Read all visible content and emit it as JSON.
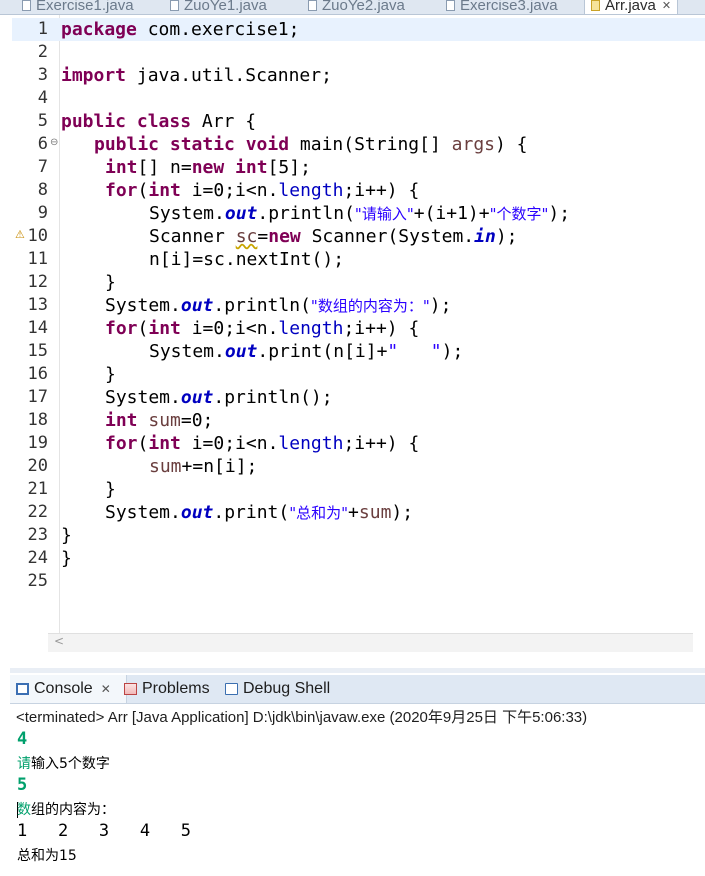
{
  "editor_tabs": [
    {
      "label": "Exercise1.java",
      "active": false
    },
    {
      "label": "ZuoYe1.java",
      "active": false
    },
    {
      "label": "ZuoYe2.java",
      "active": false
    },
    {
      "label": "Exercise3.java",
      "active": false
    },
    {
      "label": "Arr.java",
      "active": true
    }
  ],
  "line_numbers": [
    "1",
    "2",
    "3",
    "4",
    "5",
    "6",
    "7",
    "8",
    "9",
    "10",
    "11",
    "12",
    "13",
    "14",
    "15",
    "16",
    "17",
    "18",
    "19",
    "20",
    "21",
    "22",
    "23",
    "24",
    "25"
  ],
  "code": {
    "l1_kw": "package",
    "l1_rest": " com.exercise1;",
    "l3_kw": "import",
    "l3_rest": " java.util.Scanner;",
    "l5_kw": "public class",
    "l5_rest": " Arr {",
    "l6_kw": "public static void",
    "l6_rest": " main(String[] ",
    "l6_var": "args",
    "l6_end": ") {",
    "l7_kw": "int",
    "l7_a": "[] n=",
    "l7_kw2": "new int",
    "l7_b": "[5];",
    "l8_kw": "for",
    "l8_a": "(",
    "l8_kw2": "int",
    "l8_b": " i=0;i<n.",
    "l8_fld": "length",
    "l8_c": ";i++) {",
    "l9_a": "System.",
    "l9_fld": "out",
    "l9_b": ".println(",
    "l9_s1": "\"请输入\"",
    "l9_c": "+(i+1)+",
    "l9_s2": "\"个数字\"",
    "l9_d": ");",
    "l10_a": "Scanner ",
    "l10_var": "sc",
    "l10_b": "=",
    "l10_kw": "new",
    "l10_c": " Scanner(System.",
    "l10_fld": "in",
    "l10_d": ");",
    "l11": "n[i]=sc.nextInt();",
    "l12": "}",
    "l13_a": "System.",
    "l13_fld": "out",
    "l13_b": ".println(",
    "l13_s": "\"数组的内容为：\"",
    "l13_c": ");",
    "l14_kw": "for",
    "l14_a": "(",
    "l14_kw2": "int",
    "l14_b": " i=0;i<n.",
    "l14_fld": "length",
    "l14_c": ";i++) {",
    "l15_a": "System.",
    "l15_fld": "out",
    "l15_b": ".print(n[i]+",
    "l15_s": "\"   \"",
    "l15_c": ");",
    "l16": "}",
    "l17_a": "System.",
    "l17_fld": "out",
    "l17_b": ".println();",
    "l18_kw": "int",
    "l18_var": " sum",
    "l18_rest": "=0;",
    "l19_kw": "for",
    "l19_a": "(",
    "l19_kw2": "int",
    "l19_b": " i=0;i<n.",
    "l19_fld": "length",
    "l19_c": ";i++) {",
    "l20_var": "sum",
    "l20_rest": "+=n[i];",
    "l21": "}",
    "l22_a": "System.",
    "l22_fld": "out",
    "l22_b": ".print(",
    "l22_s": "\"总和为\"",
    "l22_c": "+",
    "l22_var": "sum",
    "l22_d": ");",
    "l23": "}",
    "l24": "}"
  },
  "console_tabs": [
    {
      "label": "Console",
      "icon": "console-icon",
      "active": true
    },
    {
      "label": "Problems",
      "icon": "problems-icon",
      "active": false
    },
    {
      "label": "Debug Shell",
      "icon": "debug-shell-icon",
      "active": false
    }
  ],
  "console": {
    "status": "<terminated> Arr [Java Application] D:\\jdk\\bin\\javaw.exe (2020年9月25日 下午5:06:33)",
    "input1": "4",
    "prompt_first": "请",
    "prompt_rest": "输入5个数字",
    "input2": "5",
    "content_first": "数",
    "content_rest": "组的内容为：",
    "values_line": "1   2   3   4   5",
    "sum_line": "总和为15"
  },
  "colors": {
    "keyword": "#7f0055",
    "field": "#0000c0",
    "string": "#2a00ff",
    "local_var": "#6a3e3e",
    "console_input": "#00a06c",
    "current_line": "#e8f2fe"
  }
}
